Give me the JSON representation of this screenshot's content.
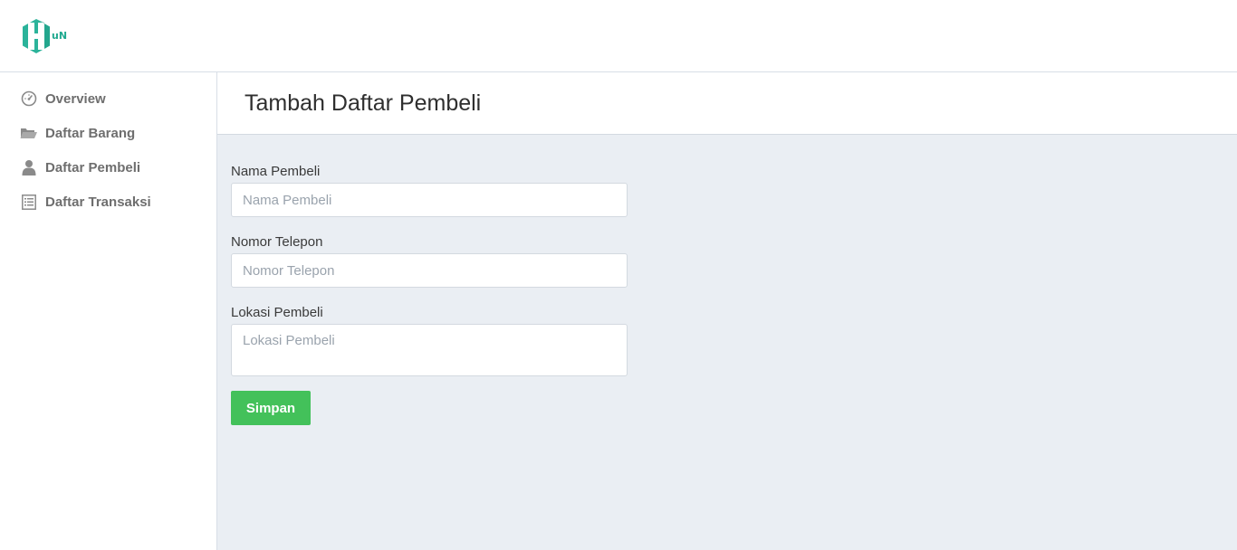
{
  "brand": {
    "logo_text": "uN",
    "accent": "#1fa98f"
  },
  "sidebar": {
    "items": [
      {
        "label": "Overview",
        "icon": "dashboard-icon"
      },
      {
        "label": "Daftar Barang",
        "icon": "folder-open-icon"
      },
      {
        "label": "Daftar Pembeli",
        "icon": "user-icon"
      },
      {
        "label": "Daftar Transaksi",
        "icon": "list-icon"
      }
    ]
  },
  "header": {
    "title": "Tambah Daftar Pembeli"
  },
  "form": {
    "name_label": "Nama Pembeli",
    "name_placeholder": "Nama Pembeli",
    "phone_label": "Nomor Telepon",
    "phone_placeholder": "Nomor Telepon",
    "location_label": "Lokasi Pembeli",
    "location_placeholder": "Lokasi Pembeli",
    "submit_label": "Simpan",
    "submit_color": "#43c15a"
  }
}
